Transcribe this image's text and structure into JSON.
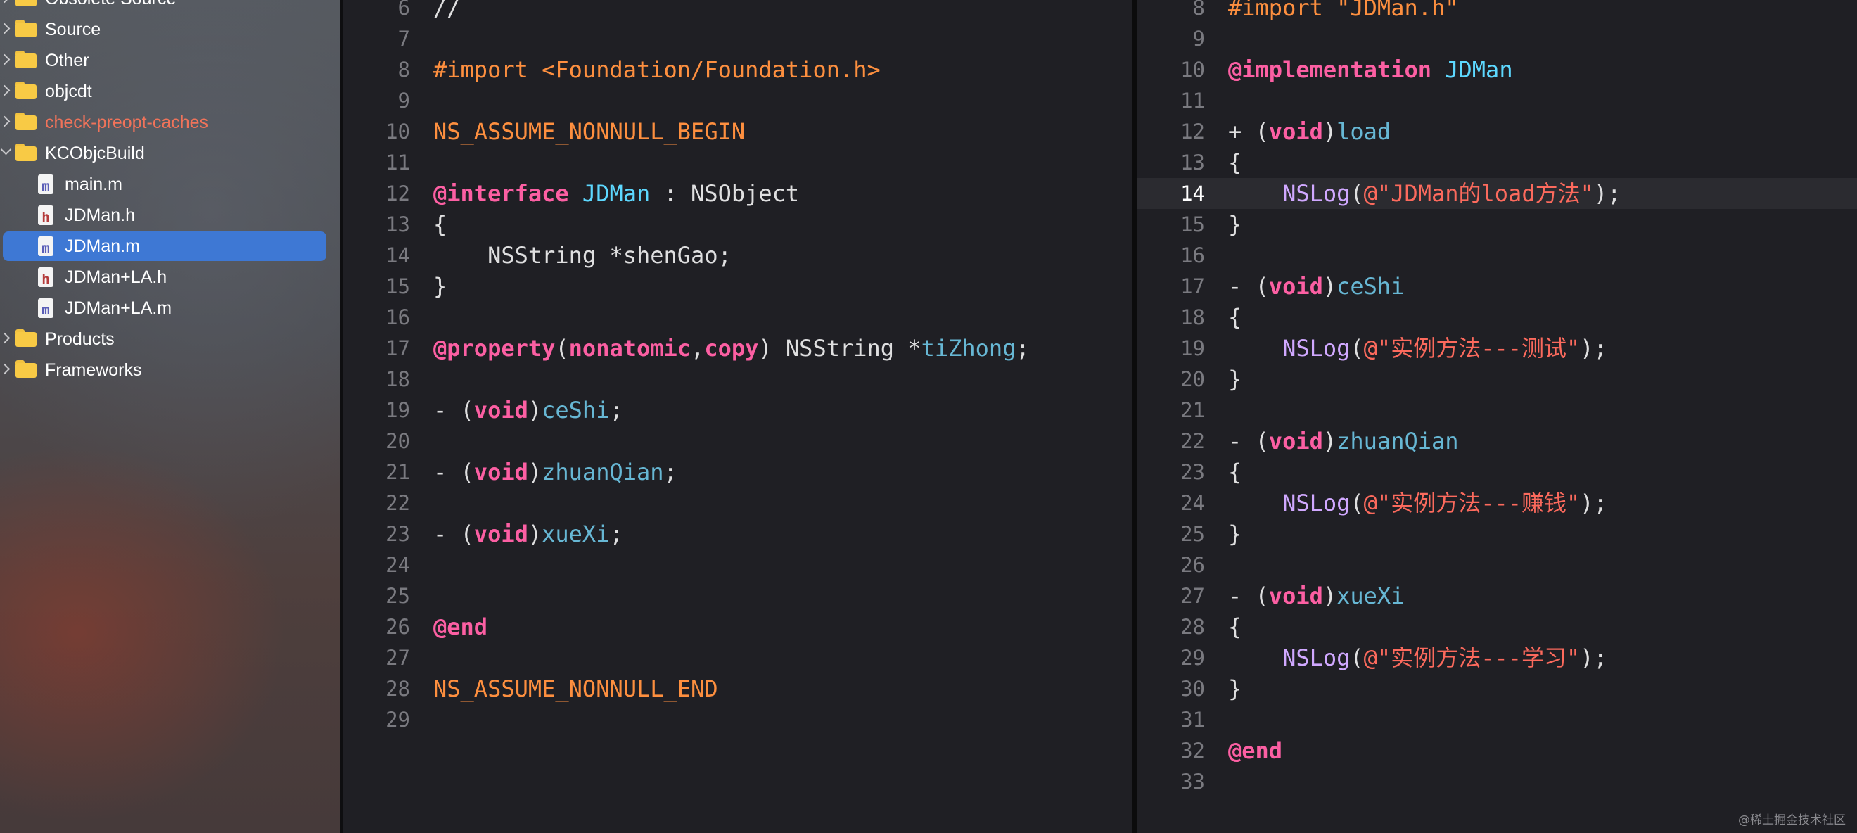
{
  "sidebar": {
    "items": [
      {
        "label": "Obsolete Source",
        "type": "folder",
        "expanded": false,
        "depth": 0,
        "selected": false,
        "color": "normal"
      },
      {
        "label": "Source",
        "type": "folder",
        "expanded": false,
        "depth": 0,
        "selected": false,
        "color": "normal"
      },
      {
        "label": "Other",
        "type": "folder",
        "expanded": false,
        "depth": 0,
        "selected": false,
        "color": "normal"
      },
      {
        "label": "objcdt",
        "type": "folder",
        "expanded": false,
        "depth": 0,
        "selected": false,
        "color": "normal"
      },
      {
        "label": "check-preopt-caches",
        "type": "folder",
        "expanded": false,
        "depth": 0,
        "selected": false,
        "color": "red"
      },
      {
        "label": "KCObjcBuild",
        "type": "folder",
        "expanded": true,
        "depth": 0,
        "selected": false,
        "color": "normal"
      },
      {
        "label": "main.m",
        "type": "file-m",
        "depth": 1,
        "selected": false,
        "color": "normal"
      },
      {
        "label": "JDMan.h",
        "type": "file-h",
        "depth": 1,
        "selected": false,
        "color": "normal"
      },
      {
        "label": "JDMan.m",
        "type": "file-m",
        "depth": 1,
        "selected": true,
        "color": "normal"
      },
      {
        "label": "JDMan+LA.h",
        "type": "file-h",
        "depth": 1,
        "selected": false,
        "color": "normal"
      },
      {
        "label": "JDMan+LA.m",
        "type": "file-m",
        "depth": 1,
        "selected": false,
        "color": "normal"
      },
      {
        "label": "Products",
        "type": "folder",
        "expanded": false,
        "depth": 0,
        "selected": false,
        "color": "normal"
      },
      {
        "label": "Frameworks",
        "type": "folder",
        "expanded": false,
        "depth": 0,
        "selected": false,
        "color": "normal"
      }
    ]
  },
  "left_editor": {
    "file": "JDMan.h",
    "lines": [
      {
        "n": "6",
        "tokens": [
          {
            "t": "//",
            "c": "txt"
          }
        ]
      },
      {
        "n": "7",
        "tokens": []
      },
      {
        "n": "8",
        "tokens": [
          {
            "t": "#import <Foundation/Foundation.h>",
            "c": "pp"
          }
        ]
      },
      {
        "n": "9",
        "tokens": []
      },
      {
        "n": "10",
        "tokens": [
          {
            "t": "NS_ASSUME_NONNULL_BEGIN",
            "c": "pp"
          }
        ]
      },
      {
        "n": "11",
        "tokens": []
      },
      {
        "n": "12",
        "tokens": [
          {
            "t": "@interface",
            "c": "kw"
          },
          {
            "t": " ",
            "c": "txt"
          },
          {
            "t": "JDMan",
            "c": "cls"
          },
          {
            "t": " : ",
            "c": "txt"
          },
          {
            "t": "NSObject",
            "c": "txt"
          }
        ]
      },
      {
        "n": "13",
        "tokens": [
          {
            "t": "{",
            "c": "txt"
          }
        ]
      },
      {
        "n": "14",
        "tokens": [
          {
            "t": "    NSString *shenGao;",
            "c": "txt"
          }
        ]
      },
      {
        "n": "15",
        "tokens": [
          {
            "t": "}",
            "c": "txt"
          }
        ]
      },
      {
        "n": "16",
        "tokens": []
      },
      {
        "n": "17",
        "tokens": [
          {
            "t": "@property",
            "c": "kw"
          },
          {
            "t": "(",
            "c": "txt"
          },
          {
            "t": "nonatomic",
            "c": "kw"
          },
          {
            "t": ",",
            "c": "txt"
          },
          {
            "t": "copy",
            "c": "kw"
          },
          {
            "t": ") NSString *",
            "c": "txt"
          },
          {
            "t": "tiZhong",
            "c": "fn"
          },
          {
            "t": ";",
            "c": "txt"
          }
        ]
      },
      {
        "n": "18",
        "tokens": []
      },
      {
        "n": "19",
        "tokens": [
          {
            "t": "- (",
            "c": "txt"
          },
          {
            "t": "void",
            "c": "kw"
          },
          {
            "t": ")",
            "c": "txt"
          },
          {
            "t": "ceShi",
            "c": "fn"
          },
          {
            "t": ";",
            "c": "txt"
          }
        ]
      },
      {
        "n": "20",
        "tokens": []
      },
      {
        "n": "21",
        "tokens": [
          {
            "t": "- (",
            "c": "txt"
          },
          {
            "t": "void",
            "c": "kw"
          },
          {
            "t": ")",
            "c": "txt"
          },
          {
            "t": "zhuanQian",
            "c": "fn"
          },
          {
            "t": ";",
            "c": "txt"
          }
        ]
      },
      {
        "n": "22",
        "tokens": []
      },
      {
        "n": "23",
        "tokens": [
          {
            "t": "- (",
            "c": "txt"
          },
          {
            "t": "void",
            "c": "kw"
          },
          {
            "t": ")",
            "c": "txt"
          },
          {
            "t": "xueXi",
            "c": "fn"
          },
          {
            "t": ";",
            "c": "txt"
          }
        ]
      },
      {
        "n": "24",
        "tokens": []
      },
      {
        "n": "25",
        "tokens": []
      },
      {
        "n": "26",
        "tokens": [
          {
            "t": "@end",
            "c": "kw"
          }
        ]
      },
      {
        "n": "27",
        "tokens": []
      },
      {
        "n": "28",
        "tokens": [
          {
            "t": "NS_ASSUME_NONNULL_END",
            "c": "pp"
          }
        ]
      },
      {
        "n": "29",
        "tokens": []
      }
    ]
  },
  "right_editor": {
    "file": "JDMan.m",
    "current_line": "14",
    "lines": [
      {
        "n": "8",
        "tokens": [
          {
            "t": "#import \"JDMan.h\"",
            "c": "pp"
          }
        ]
      },
      {
        "n": "9",
        "tokens": []
      },
      {
        "n": "10",
        "tokens": [
          {
            "t": "@implementation",
            "c": "kw"
          },
          {
            "t": " ",
            "c": "txt"
          },
          {
            "t": "JDMan",
            "c": "cls"
          }
        ]
      },
      {
        "n": "11",
        "tokens": []
      },
      {
        "n": "12",
        "tokens": [
          {
            "t": "+ (",
            "c": "txt"
          },
          {
            "t": "void",
            "c": "kw"
          },
          {
            "t": ")",
            "c": "txt"
          },
          {
            "t": "load",
            "c": "fn"
          }
        ]
      },
      {
        "n": "13",
        "tokens": [
          {
            "t": "{",
            "c": "txt"
          }
        ]
      },
      {
        "n": "14",
        "tokens": [
          {
            "t": "    ",
            "c": "txt"
          },
          {
            "t": "NSLog",
            "c": "tp"
          },
          {
            "t": "(",
            "c": "txt"
          },
          {
            "t": "@\"JDMan的load方法\"",
            "c": "str"
          },
          {
            "t": ");",
            "c": "txt"
          }
        ]
      },
      {
        "n": "15",
        "tokens": [
          {
            "t": "}",
            "c": "txt"
          }
        ]
      },
      {
        "n": "16",
        "tokens": []
      },
      {
        "n": "17",
        "tokens": [
          {
            "t": "- (",
            "c": "txt"
          },
          {
            "t": "void",
            "c": "kw"
          },
          {
            "t": ")",
            "c": "txt"
          },
          {
            "t": "ceShi",
            "c": "fn"
          }
        ]
      },
      {
        "n": "18",
        "tokens": [
          {
            "t": "{",
            "c": "txt"
          }
        ]
      },
      {
        "n": "19",
        "tokens": [
          {
            "t": "    ",
            "c": "txt"
          },
          {
            "t": "NSLog",
            "c": "tp"
          },
          {
            "t": "(",
            "c": "txt"
          },
          {
            "t": "@\"实例方法---测试\"",
            "c": "str"
          },
          {
            "t": ");",
            "c": "txt"
          }
        ]
      },
      {
        "n": "20",
        "tokens": [
          {
            "t": "}",
            "c": "txt"
          }
        ]
      },
      {
        "n": "21",
        "tokens": []
      },
      {
        "n": "22",
        "tokens": [
          {
            "t": "- (",
            "c": "txt"
          },
          {
            "t": "void",
            "c": "kw"
          },
          {
            "t": ")",
            "c": "txt"
          },
          {
            "t": "zhuanQian",
            "c": "fn"
          }
        ]
      },
      {
        "n": "23",
        "tokens": [
          {
            "t": "{",
            "c": "txt"
          }
        ]
      },
      {
        "n": "24",
        "tokens": [
          {
            "t": "    ",
            "c": "txt"
          },
          {
            "t": "NSLog",
            "c": "tp"
          },
          {
            "t": "(",
            "c": "txt"
          },
          {
            "t": "@\"实例方法---赚钱\"",
            "c": "str"
          },
          {
            "t": ");",
            "c": "txt"
          }
        ]
      },
      {
        "n": "25",
        "tokens": [
          {
            "t": "}",
            "c": "txt"
          }
        ]
      },
      {
        "n": "26",
        "tokens": []
      },
      {
        "n": "27",
        "tokens": [
          {
            "t": "- (",
            "c": "txt"
          },
          {
            "t": "void",
            "c": "kw"
          },
          {
            "t": ")",
            "c": "txt"
          },
          {
            "t": "xueXi",
            "c": "fn"
          }
        ]
      },
      {
        "n": "28",
        "tokens": [
          {
            "t": "{",
            "c": "txt"
          }
        ]
      },
      {
        "n": "29",
        "tokens": [
          {
            "t": "    ",
            "c": "txt"
          },
          {
            "t": "NSLog",
            "c": "tp"
          },
          {
            "t": "(",
            "c": "txt"
          },
          {
            "t": "@\"实例方法---学习\"",
            "c": "str"
          },
          {
            "t": ");",
            "c": "txt"
          }
        ]
      },
      {
        "n": "30",
        "tokens": [
          {
            "t": "}",
            "c": "txt"
          }
        ]
      },
      {
        "n": "31",
        "tokens": []
      },
      {
        "n": "32",
        "tokens": [
          {
            "t": "@end",
            "c": "kw"
          }
        ]
      },
      {
        "n": "33",
        "tokens": []
      }
    ]
  },
  "watermark": "@稀土掘金技术社区"
}
